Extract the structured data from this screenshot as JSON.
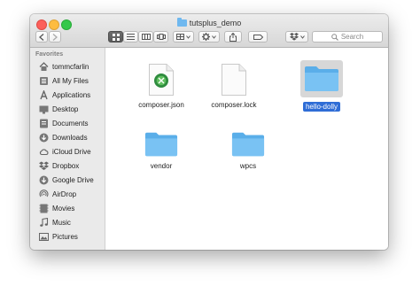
{
  "window": {
    "title": "tutsplus_demo"
  },
  "toolbar": {
    "back_icon": "chevron-left-icon",
    "forward_icon": "chevron-right-icon",
    "view_icons": [
      "icon-view-icon",
      "list-view-icon",
      "column-view-icon",
      "cover-flow-icon"
    ],
    "arrange_icon": "arrange-icon",
    "action_icon": "gear-icon",
    "share_icon": "share-icon",
    "tags_icon": "tag-icon",
    "dropbox_icon": "dropbox-icon",
    "search_placeholder": "Search"
  },
  "sidebar": {
    "heading": "Favorites",
    "items": [
      {
        "label": "tommcfarlin",
        "icon": "home-icon"
      },
      {
        "label": "All My Files",
        "icon": "all-files-icon"
      },
      {
        "label": "Applications",
        "icon": "applications-icon"
      },
      {
        "label": "Desktop",
        "icon": "desktop-icon"
      },
      {
        "label": "Documents",
        "icon": "documents-icon"
      },
      {
        "label": "Downloads",
        "icon": "downloads-icon"
      },
      {
        "label": "iCloud Drive",
        "icon": "cloud-icon"
      },
      {
        "label": "Dropbox",
        "icon": "dropbox-icon"
      },
      {
        "label": "Google Drive",
        "icon": "google-drive-icon"
      },
      {
        "label": "AirDrop",
        "icon": "airdrop-icon"
      },
      {
        "label": "Movies",
        "icon": "movies-icon"
      },
      {
        "label": "Music",
        "icon": "music-icon"
      },
      {
        "label": "Pictures",
        "icon": "pictures-icon"
      }
    ]
  },
  "files": [
    {
      "name": "composer.json",
      "kind": "json-file",
      "selected": false
    },
    {
      "name": "composer.lock",
      "kind": "lock-file",
      "selected": false
    },
    {
      "name": "hello-dolly",
      "kind": "folder",
      "selected": true
    },
    {
      "name": "vendor",
      "kind": "folder",
      "selected": false
    },
    {
      "name": "wpcs",
      "kind": "folder",
      "selected": false
    }
  ],
  "colors": {
    "folder": "#6fb8ef",
    "selection": "#2f6dd6",
    "sidebar": "#eaeaea"
  }
}
